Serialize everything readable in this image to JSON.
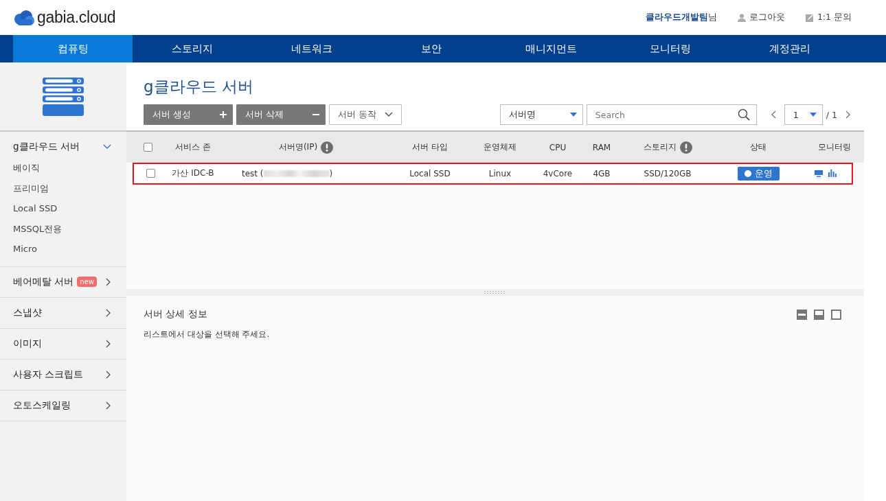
{
  "header": {
    "logo": "gabia.cloud",
    "user": {
      "name": "클라우드개발팀",
      "suffix": "님"
    },
    "links": [
      {
        "kind": "logout",
        "label": "로그아웃"
      },
      {
        "kind": "inquiry",
        "label": "1:1 문의"
      }
    ]
  },
  "nav": [
    {
      "label": "컴퓨팅",
      "selected": true
    },
    {
      "label": "스토리지",
      "selected": false
    },
    {
      "label": "네트워크",
      "selected": false
    },
    {
      "label": "보안",
      "selected": false
    },
    {
      "label": "매니지먼트",
      "selected": false
    },
    {
      "label": "모니터링",
      "selected": false
    },
    {
      "label": "계정관리",
      "selected": false
    }
  ],
  "sidebar": [
    {
      "label": "g클라우드 서버",
      "expanded": true,
      "items": [
        "베이직",
        "프리미엄",
        "Local SSD",
        "MSSQL전용",
        "Micro"
      ]
    },
    {
      "label": "베어메탈 서버",
      "expanded": false,
      "badge": "new"
    },
    {
      "label": "스냅샷",
      "expanded": false
    },
    {
      "label": "이미지",
      "expanded": false
    },
    {
      "label": "사용자 스크립트",
      "expanded": false
    },
    {
      "label": "오토스케일링",
      "expanded": false
    }
  ],
  "main": {
    "title": "g클라우드 서버",
    "actions": [
      {
        "kind": "add",
        "label": "서버 생성"
      },
      {
        "kind": "remove",
        "label": "서버 삭제"
      },
      {
        "kind": "dropdown",
        "label": "서버 동작"
      }
    ],
    "filter": "서버명",
    "search": {
      "placeholder": "Search"
    },
    "pagination": {
      "page": "1",
      "total": "/ 1"
    }
  },
  "table": {
    "select_all_checked": false,
    "columns": [
      {
        "label": "서비스 존",
        "info": false
      },
      {
        "label": "서버명(IP)",
        "info": true
      },
      {
        "label": "서버 타입",
        "info": false
      },
      {
        "label": "운영체제",
        "info": false
      },
      {
        "label": "CPU",
        "info": false
      },
      {
        "label": "RAM",
        "info": false
      },
      {
        "label": "스토리지",
        "info": true
      },
      {
        "label": "상태",
        "info": false
      },
      {
        "label": "모니터링",
        "info": false
      }
    ],
    "rows": [
      {
        "selected": true,
        "checked": false,
        "zone": "가산 IDC-B",
        "name": "test (",
        "name_end": ")",
        "type": "Local SSD",
        "os": "Linux",
        "cpu": "4vCore",
        "ram": "4GB",
        "storage": "SSD/120GB",
        "status": {
          "label": "운영",
          "kind": "running"
        }
      }
    ]
  },
  "detail": {
    "title": "서버 상세 정보",
    "message": "리스트에서 대상을 선택해 주세요."
  }
}
